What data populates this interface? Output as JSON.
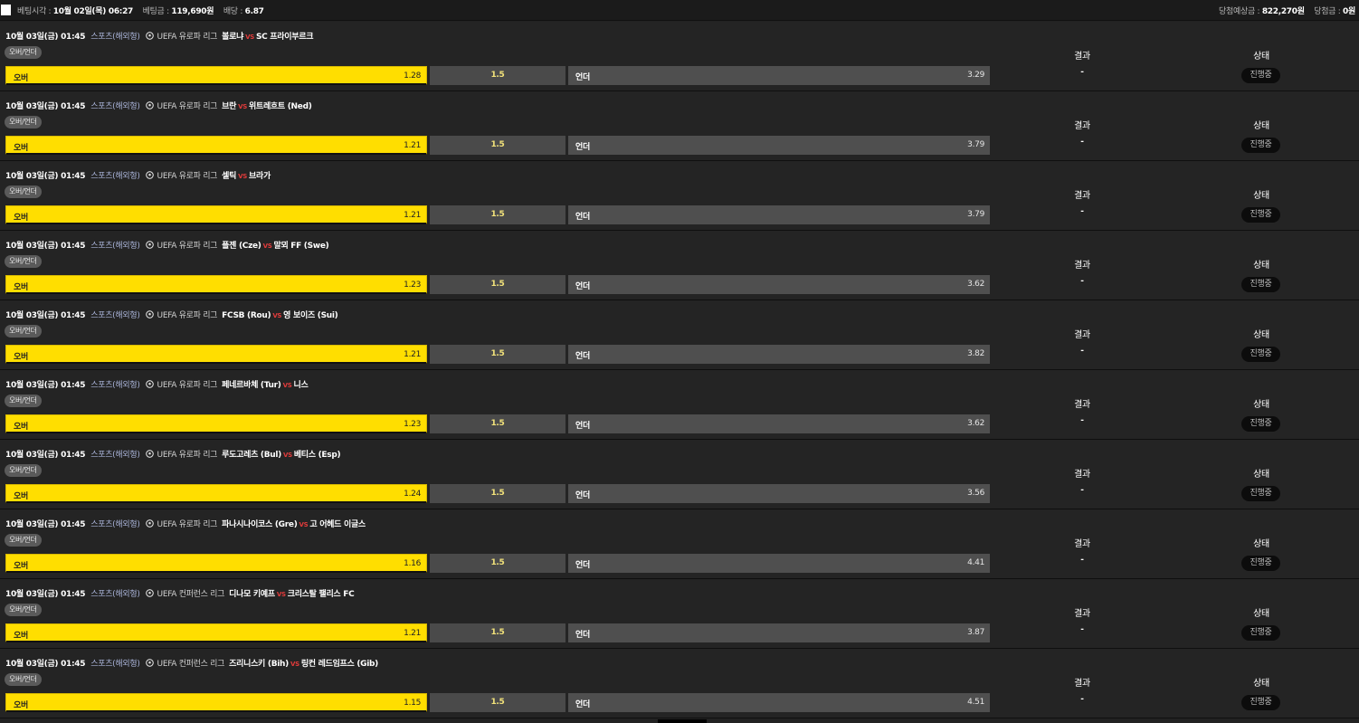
{
  "summary": {
    "bet_time_label": "베팅시각 :",
    "bet_time": "10월 02일(목) 06:27",
    "bet_amount_label": "베팅금 :",
    "bet_amount": "119,690원",
    "odds_label": "배당 :",
    "odds": "6.87",
    "expected_win_label": "당첨예상금 :",
    "expected_win": "822,270원",
    "win_amount_label": "당첨금 :",
    "win_amount": "0원"
  },
  "colors": {
    "over_bg": "#ffde00",
    "vs": "#e23b3b",
    "bg": "#242424"
  },
  "bets": [
    {
      "datetime": "10월 03일(금) 01:45",
      "sport": "스포츠(해외형)",
      "league": "UEFA 유로파 리그",
      "home": "볼로냐",
      "away": "SC 프라이부르크",
      "type": "오버/언더",
      "over_label": "오버",
      "over_odds": "1.28",
      "line": "1.5",
      "under_label": "언더",
      "under_odds": "3.29",
      "result_label": "결과",
      "result": "-",
      "status_label": "상태",
      "status": "진행중"
    },
    {
      "datetime": "10월 03일(금) 01:45",
      "sport": "스포츠(해외형)",
      "league": "UEFA 유로파 리그",
      "home": "브란",
      "away": "위트레흐트 (Ned)",
      "type": "오버/언더",
      "over_label": "오버",
      "over_odds": "1.21",
      "line": "1.5",
      "under_label": "언더",
      "under_odds": "3.79",
      "result_label": "결과",
      "result": "-",
      "status_label": "상태",
      "status": "진행중"
    },
    {
      "datetime": "10월 03일(금) 01:45",
      "sport": "스포츠(해외형)",
      "league": "UEFA 유로파 리그",
      "home": "셀틱",
      "away": "브라가",
      "type": "오버/언더",
      "over_label": "오버",
      "over_odds": "1.21",
      "line": "1.5",
      "under_label": "언더",
      "under_odds": "3.79",
      "result_label": "결과",
      "result": "-",
      "status_label": "상태",
      "status": "진행중"
    },
    {
      "datetime": "10월 03일(금) 01:45",
      "sport": "스포츠(해외형)",
      "league": "UEFA 유로파 리그",
      "home": "플젠 (Cze)",
      "away": "말뫼 FF (Swe)",
      "type": "오버/언더",
      "over_label": "오버",
      "over_odds": "1.23",
      "line": "1.5",
      "under_label": "언더",
      "under_odds": "3.62",
      "result_label": "결과",
      "result": "-",
      "status_label": "상태",
      "status": "진행중"
    },
    {
      "datetime": "10월 03일(금) 01:45",
      "sport": "스포츠(해외형)",
      "league": "UEFA 유로파 리그",
      "home": "FCSB (Rou)",
      "away": "영 보이즈 (Sui)",
      "type": "오버/언더",
      "over_label": "오버",
      "over_odds": "1.21",
      "line": "1.5",
      "under_label": "언더",
      "under_odds": "3.82",
      "result_label": "결과",
      "result": "-",
      "status_label": "상태",
      "status": "진행중"
    },
    {
      "datetime": "10월 03일(금) 01:45",
      "sport": "스포츠(해외형)",
      "league": "UEFA 유로파 리그",
      "home": "페네르바체 (Tur)",
      "away": "니스",
      "type": "오버/언더",
      "over_label": "오버",
      "over_odds": "1.23",
      "line": "1.5",
      "under_label": "언더",
      "under_odds": "3.62",
      "result_label": "결과",
      "result": "-",
      "status_label": "상태",
      "status": "진행중"
    },
    {
      "datetime": "10월 03일(금) 01:45",
      "sport": "스포츠(해외형)",
      "league": "UEFA 유로파 리그",
      "home": "루도고레츠 (Bul)",
      "away": "베티스 (Esp)",
      "type": "오버/언더",
      "over_label": "오버",
      "over_odds": "1.24",
      "line": "1.5",
      "under_label": "언더",
      "under_odds": "3.56",
      "result_label": "결과",
      "result": "-",
      "status_label": "상태",
      "status": "진행중"
    },
    {
      "datetime": "10월 03일(금) 01:45",
      "sport": "스포츠(해외형)",
      "league": "UEFA 유로파 리그",
      "home": "파나시나이코스 (Gre)",
      "away": "고 어헤드 이글스",
      "type": "오버/언더",
      "over_label": "오버",
      "over_odds": "1.16",
      "line": "1.5",
      "under_label": "언더",
      "under_odds": "4.41",
      "result_label": "결과",
      "result": "-",
      "status_label": "상태",
      "status": "진행중"
    },
    {
      "datetime": "10월 03일(금) 01:45",
      "sport": "스포츠(해외형)",
      "league": "UEFA 컨퍼런스 리그",
      "home": "디나모 키예프",
      "away": "크리스탈 팰리스 FC",
      "type": "오버/언더",
      "over_label": "오버",
      "over_odds": "1.21",
      "line": "1.5",
      "under_label": "언더",
      "under_odds": "3.87",
      "result_label": "결과",
      "result": "-",
      "status_label": "상태",
      "status": "진행중"
    },
    {
      "datetime": "10월 03일(금) 01:45",
      "sport": "스포츠(해외형)",
      "league": "UEFA 컨퍼런스 리그",
      "home": "즈리니스키 (Bih)",
      "away": "링컨 레드임프스 (Gib)",
      "type": "오버/언더",
      "over_label": "오버",
      "over_odds": "1.15",
      "line": "1.5",
      "under_label": "언더",
      "under_odds": "4.51",
      "result_label": "결과",
      "result": "-",
      "status_label": "상태",
      "status": "진행중"
    }
  ]
}
